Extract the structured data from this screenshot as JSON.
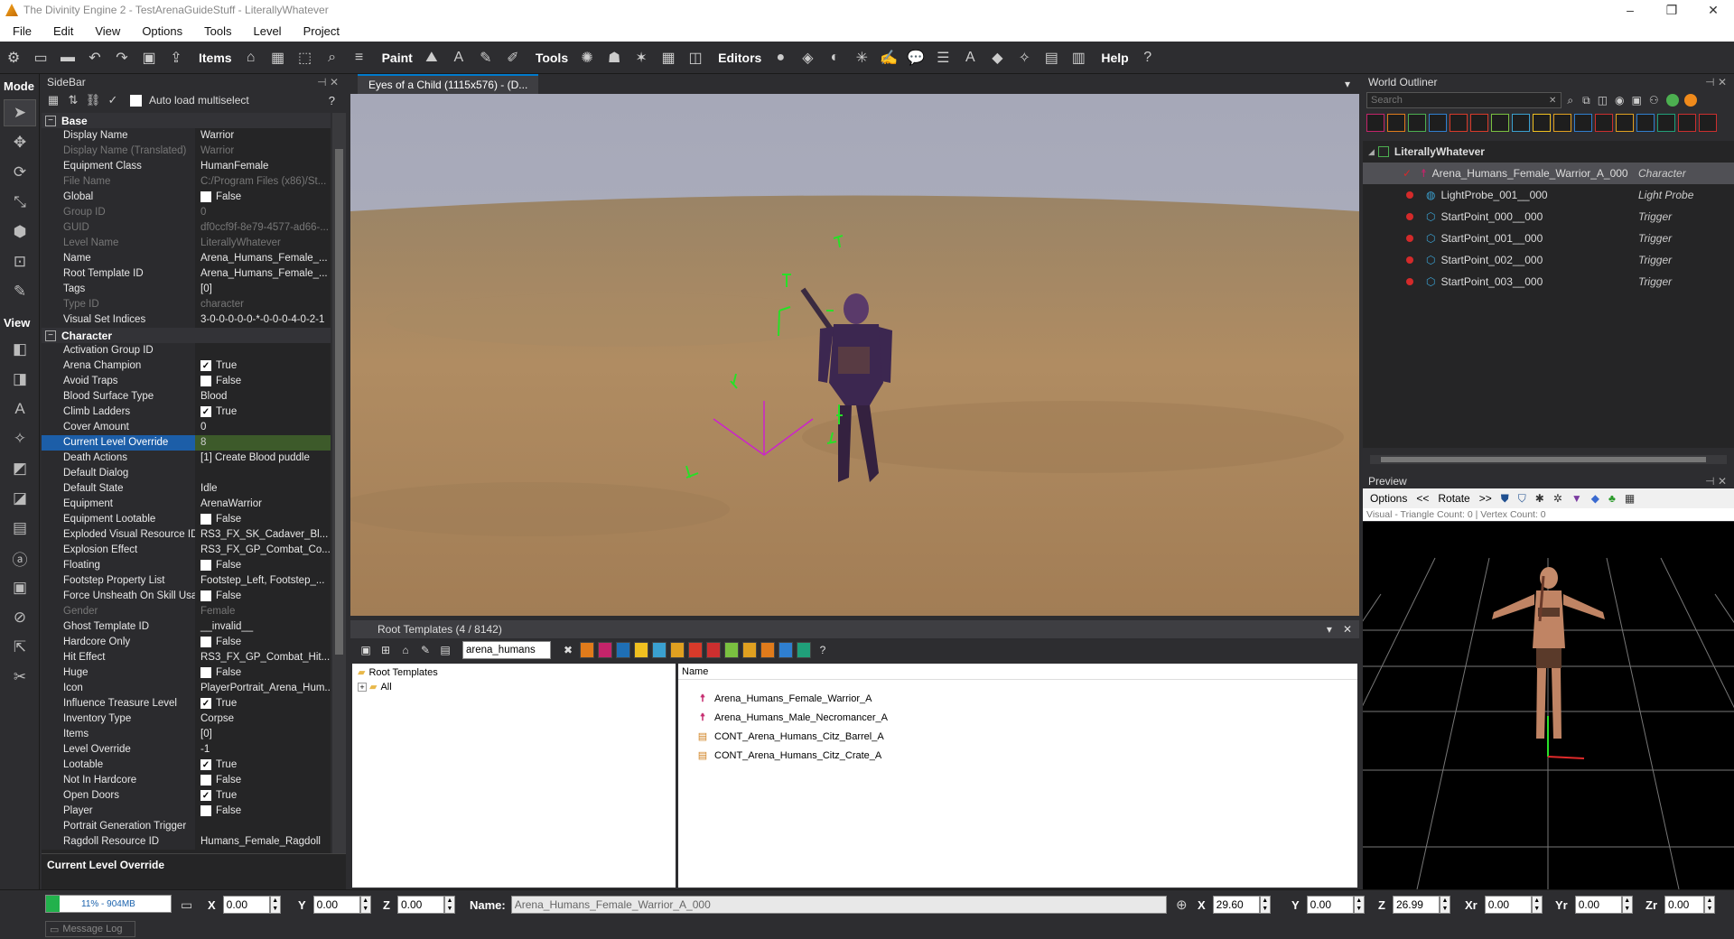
{
  "window": {
    "title": "The Divinity Engine 2 - TestArenaGuideStuff - LiterallyWhatever"
  },
  "menu": [
    "File",
    "Edit",
    "View",
    "Options",
    "Tools",
    "Level",
    "Project"
  ],
  "toolbar": {
    "items_label": "Items",
    "paint_label": "Paint",
    "tools_label": "Tools",
    "editors_label": "Editors",
    "help_label": "Help"
  },
  "mode": {
    "title": "Mode",
    "view_title": "View"
  },
  "sidebar": {
    "title": "SideBar",
    "auto_load_label": "Auto load multiselect",
    "help": "?",
    "categories": [
      {
        "name": "Base",
        "rows": [
          {
            "n": "Display Name",
            "v": "Warrior"
          },
          {
            "n": "Display Name (Translated)",
            "v": "Warrior",
            "dim": true
          },
          {
            "n": "Equipment Class",
            "v": "HumanFemale"
          },
          {
            "n": "File Name",
            "v": "C:/Program Files (x86)/St...",
            "dim": true
          },
          {
            "n": "Global",
            "v": "False",
            "cb": "off"
          },
          {
            "n": "Group ID",
            "v": "0",
            "dim": true
          },
          {
            "n": "GUID",
            "v": "df0ccf9f-8e79-4577-ad66-...",
            "dim": true
          },
          {
            "n": "Level Name",
            "v": "LiterallyWhatever",
            "dim": true
          },
          {
            "n": "Name",
            "v": "Arena_Humans_Female_..."
          },
          {
            "n": "Root Template ID",
            "v": "Arena_Humans_Female_..."
          },
          {
            "n": "Tags",
            "v": "[0]"
          },
          {
            "n": "Type ID",
            "v": "character",
            "dim": true
          },
          {
            "n": "Visual Set Indices",
            "v": "3-0-0-0-0-0-*-0-0-0-4-0-2-1"
          }
        ]
      },
      {
        "name": "Character",
        "rows": [
          {
            "n": "Activation Group ID",
            "v": ""
          },
          {
            "n": "Arena Champion",
            "v": "True",
            "cb": "on"
          },
          {
            "n": "Avoid Traps",
            "v": "False",
            "cb": "off"
          },
          {
            "n": "Blood Surface Type",
            "v": "Blood"
          },
          {
            "n": "Climb Ladders",
            "v": "True",
            "cb": "on"
          },
          {
            "n": "Cover Amount",
            "v": "0"
          },
          {
            "n": "Current Level Override",
            "v": "8",
            "sel": true
          },
          {
            "n": "Death Actions",
            "v": "[1] Create Blood puddle"
          },
          {
            "n": "Default Dialog",
            "v": ""
          },
          {
            "n": "Default State",
            "v": "Idle"
          },
          {
            "n": "Equipment",
            "v": "ArenaWarrior"
          },
          {
            "n": "Equipment Lootable",
            "v": "False",
            "cb": "off"
          },
          {
            "n": "Exploded Visual Resource ID",
            "v": "RS3_FX_SK_Cadaver_Bl..."
          },
          {
            "n": "Explosion Effect",
            "v": "RS3_FX_GP_Combat_Co..."
          },
          {
            "n": "Floating",
            "v": "False",
            "cb": "off"
          },
          {
            "n": "Footstep Property List",
            "v": "Footstep_Left, Footstep_..."
          },
          {
            "n": "Force Unsheath On Skill Usage",
            "v": "False",
            "cb": "off"
          },
          {
            "n": "Gender",
            "v": "Female",
            "dim": true
          },
          {
            "n": "Ghost Template ID",
            "v": "__invalid__"
          },
          {
            "n": "Hardcore Only",
            "v": "False",
            "cb": "off"
          },
          {
            "n": "Hit Effect",
            "v": "RS3_FX_GP_Combat_Hit..."
          },
          {
            "n": "Huge",
            "v": "False",
            "cb": "off"
          },
          {
            "n": "Icon",
            "v": "PlayerPortrait_Arena_Hum..."
          },
          {
            "n": "Influence Treasure Level",
            "v": "True",
            "cb": "on"
          },
          {
            "n": "Inventory Type",
            "v": "Corpse"
          },
          {
            "n": "Items",
            "v": "[0]"
          },
          {
            "n": "Level Override",
            "v": "-1"
          },
          {
            "n": "Lootable",
            "v": "True",
            "cb": "on"
          },
          {
            "n": "Not In Hardcore",
            "v": "False",
            "cb": "off"
          },
          {
            "n": "Open Doors",
            "v": "True",
            "cb": "on"
          },
          {
            "n": "Player",
            "v": "False",
            "cb": "off"
          },
          {
            "n": "Portrait Generation Trigger",
            "v": ""
          },
          {
            "n": "Ragdoll Resource ID",
            "v": "Humans_Female_Ragdoll"
          }
        ]
      }
    ],
    "description": "Current Level Override"
  },
  "viewport": {
    "tab": "Eyes of a Child (1115x576) - (D..."
  },
  "root_templates": {
    "title": "Root Templates (4 / 8142)",
    "search_value": "arena_humans",
    "tree_root": "Root Templates",
    "tree_all": "All",
    "col_name": "Name",
    "items": [
      {
        "name": "Arena_Humans_Female_Warrior_A",
        "icon": "character-icon"
      },
      {
        "name": "Arena_Humans_Male_Necromancer_A",
        "icon": "character-icon"
      },
      {
        "name": "CONT_Arena_Humans_Citz_Barrel_A",
        "icon": "container-icon"
      },
      {
        "name": "CONT_Arena_Humans_Citz_Crate_A",
        "icon": "container-icon"
      }
    ]
  },
  "outliner": {
    "title": "World Outliner",
    "search_placeholder": "Search",
    "level": "LiterallyWhatever",
    "items": [
      {
        "name": "Arena_Humans_Female_Warrior_A_000",
        "type": "Character",
        "sel": true
      },
      {
        "name": "LightProbe_001__000",
        "type": "Light Probe"
      },
      {
        "name": "StartPoint_000__000",
        "type": "Trigger"
      },
      {
        "name": "StartPoint_001__000",
        "type": "Trigger"
      },
      {
        "name": "StartPoint_002__000",
        "type": "Trigger"
      },
      {
        "name": "StartPoint_003__000",
        "type": "Trigger"
      }
    ]
  },
  "preview": {
    "title": "Preview",
    "options": "Options",
    "prev": "<<",
    "rotate": "Rotate",
    "next": ">>",
    "info": "Visual  -  Triangle Count: 0  |  Vertex Count: 0"
  },
  "status": {
    "memory": "11% - 904MB",
    "memory_fraction": 0.11,
    "x_label": "X",
    "y_label": "Y",
    "z_label": "Z",
    "x": "0.00",
    "y": "0.00",
    "z": "0.00",
    "name_label": "Name:",
    "name_value": "Arena_Humans_Female_Warrior_A_000",
    "rx": "29.60",
    "ry": "0.00",
    "rz": "26.99",
    "xr_label": "Xr",
    "yr_label": "Yr",
    "zr_label": "Zr",
    "xr": "0.00",
    "yr": "0.00",
    "zr": "0.00",
    "msglog": "Message Log"
  },
  "colors": {
    "accent": "#007acc",
    "selection": "#1c5ea8",
    "panel": "#2d2d30"
  }
}
